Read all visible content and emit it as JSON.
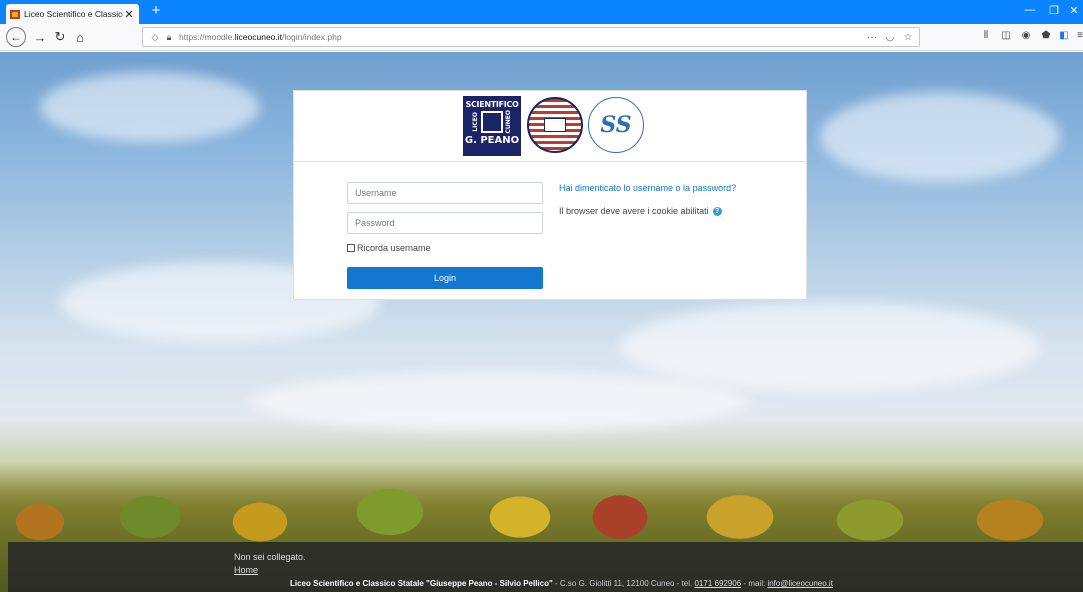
{
  "browser": {
    "tab_title": "Liceo Scientifico e Classico Stat",
    "tab_close": "✕",
    "new_tab": "+",
    "url_prefix": "https://moodle.",
    "url_domain": "liceocuneo.it",
    "url_path": "/login/index.php",
    "page_actions": "···"
  },
  "logos": {
    "school_top": "SCIENTIFICO",
    "school_left": "LICEO",
    "school_right": "CUNEO",
    "school_bottom": "G. PEANO"
  },
  "login": {
    "username_placeholder": "Username",
    "password_placeholder": "Password",
    "remember_label": "Ricorda username",
    "login_button": "Login",
    "forgot_link": "Hai dimenticato lo username o la password?",
    "cookie_notice": "Il browser deve avere i cookie abilitati",
    "help_glyph": "?"
  },
  "footer": {
    "not_logged": "Non sei collegato.",
    "home_link": "Home",
    "school_name": "Liceo Scientifico e Classico Statale \"Giuseppe Peano - Silvio Pellico\"",
    "address": " - C.so G. Giolitti 11, 12100 Cuneo - tel. ",
    "phone": "0171 692906",
    "mail_label": " - mail: ",
    "email": "info@liceocuneo.it"
  }
}
